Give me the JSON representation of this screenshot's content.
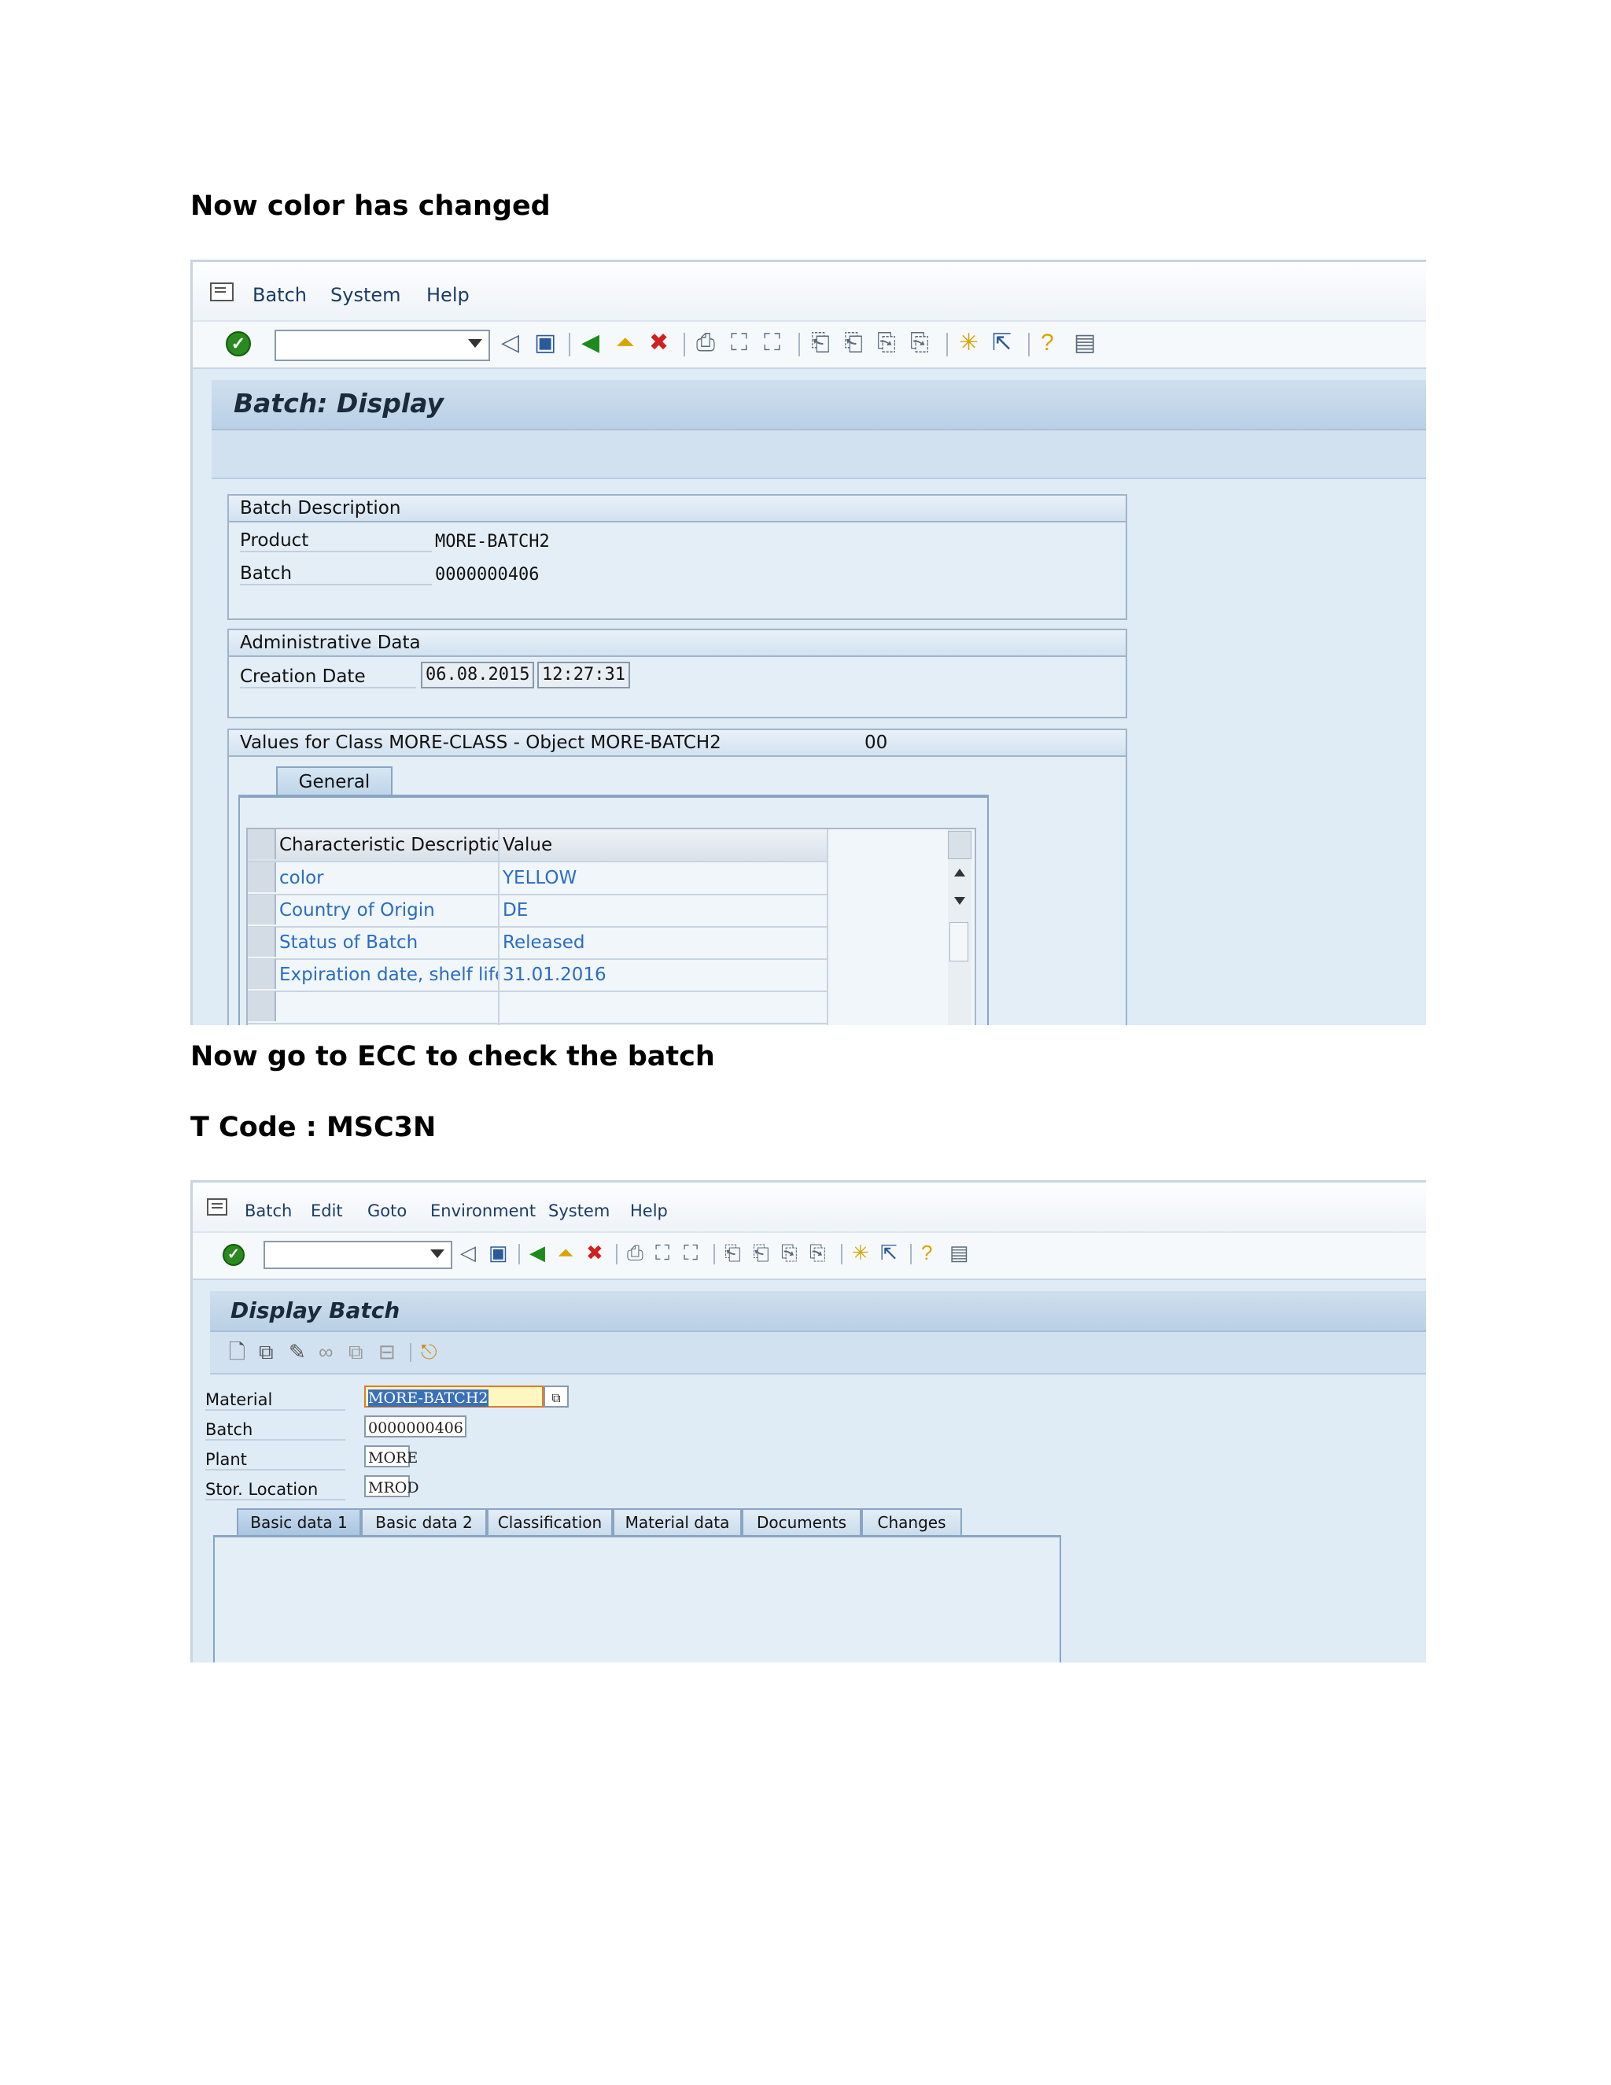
{
  "doc": {
    "heading1": "Now color has changed",
    "heading2": "Now go to ECC to check the batch",
    "heading3": "T Code : MSC3N"
  },
  "shot1": {
    "menu": [
      "Batch",
      "System",
      "Help"
    ],
    "title": "Batch: Display",
    "batch_description": {
      "title": "Batch Description",
      "product_label": "Product",
      "product_value": "MORE-BATCH2",
      "batch_label": "Batch",
      "batch_value": "0000000406"
    },
    "admin_data": {
      "title": "Administrative Data",
      "creation_label": "Creation Date",
      "creation_date": "06.08.2015",
      "creation_time": "12:27:31"
    },
    "class_values": {
      "title": "Values for Class MORE-CLASS - Object MORE-BATCH2",
      "number": "00",
      "tab": "General",
      "columns": [
        "Characteristic Description",
        "Value"
      ],
      "rows": [
        {
          "desc": "color",
          "value": "YELLOW"
        },
        {
          "desc": "Country of Origin",
          "value": "DE"
        },
        {
          "desc": "Status of Batch",
          "value": "Released"
        },
        {
          "desc": "Expiration date, shelf life",
          "value": "31.01.2016"
        }
      ]
    }
  },
  "shot2": {
    "menu": [
      "Batch",
      "Edit",
      "Goto",
      "Environment",
      "System",
      "Help"
    ],
    "title": "Display Batch",
    "fields": [
      {
        "label": "Material",
        "value": "MORE-BATCH2"
      },
      {
        "label": "Batch",
        "value": "0000000406"
      },
      {
        "label": "Plant",
        "value": "MORE"
      },
      {
        "label": "Stor. Location",
        "value": "MROD"
      }
    ],
    "tabs": [
      "Basic data 1",
      "Basic data 2",
      "Classification",
      "Material data",
      "Documents",
      "Changes"
    ]
  }
}
